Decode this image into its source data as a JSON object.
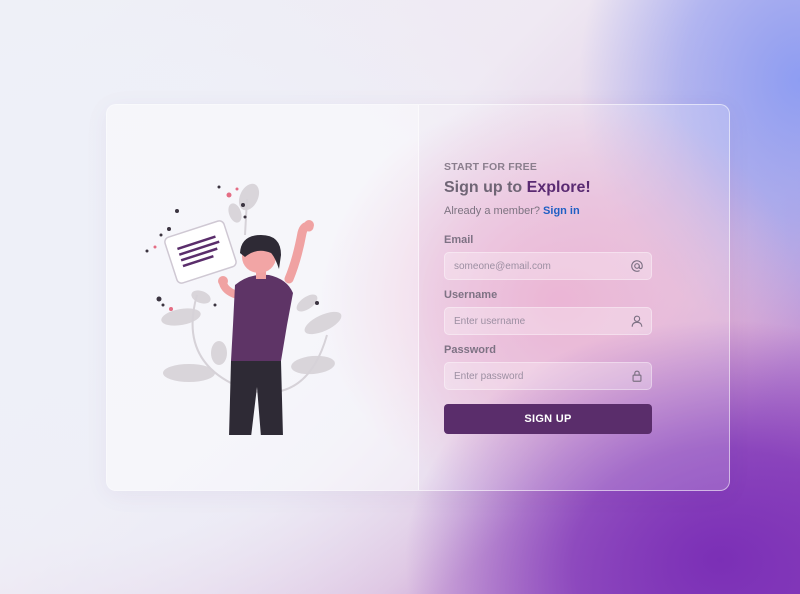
{
  "signup": {
    "eyebrow": "START FOR FREE",
    "headline_prefix": "Sign up to ",
    "headline_accent": "Explore!",
    "member_text": "Already a member? ",
    "signin_link": "Sign in",
    "email": {
      "label": "Email",
      "placeholder": "someone@email.com",
      "value": "",
      "icon": "at-icon"
    },
    "username": {
      "label": "Username",
      "placeholder": "Enter username",
      "value": "",
      "icon": "user-icon"
    },
    "password": {
      "label": "Password",
      "placeholder": "Enter password",
      "value": "",
      "icon": "lock-icon"
    },
    "button_label": "SIGN UP"
  },
  "colors": {
    "button": "#5a2d6b",
    "accent_text": "#5a2a72",
    "link": "#1f5fc4"
  }
}
